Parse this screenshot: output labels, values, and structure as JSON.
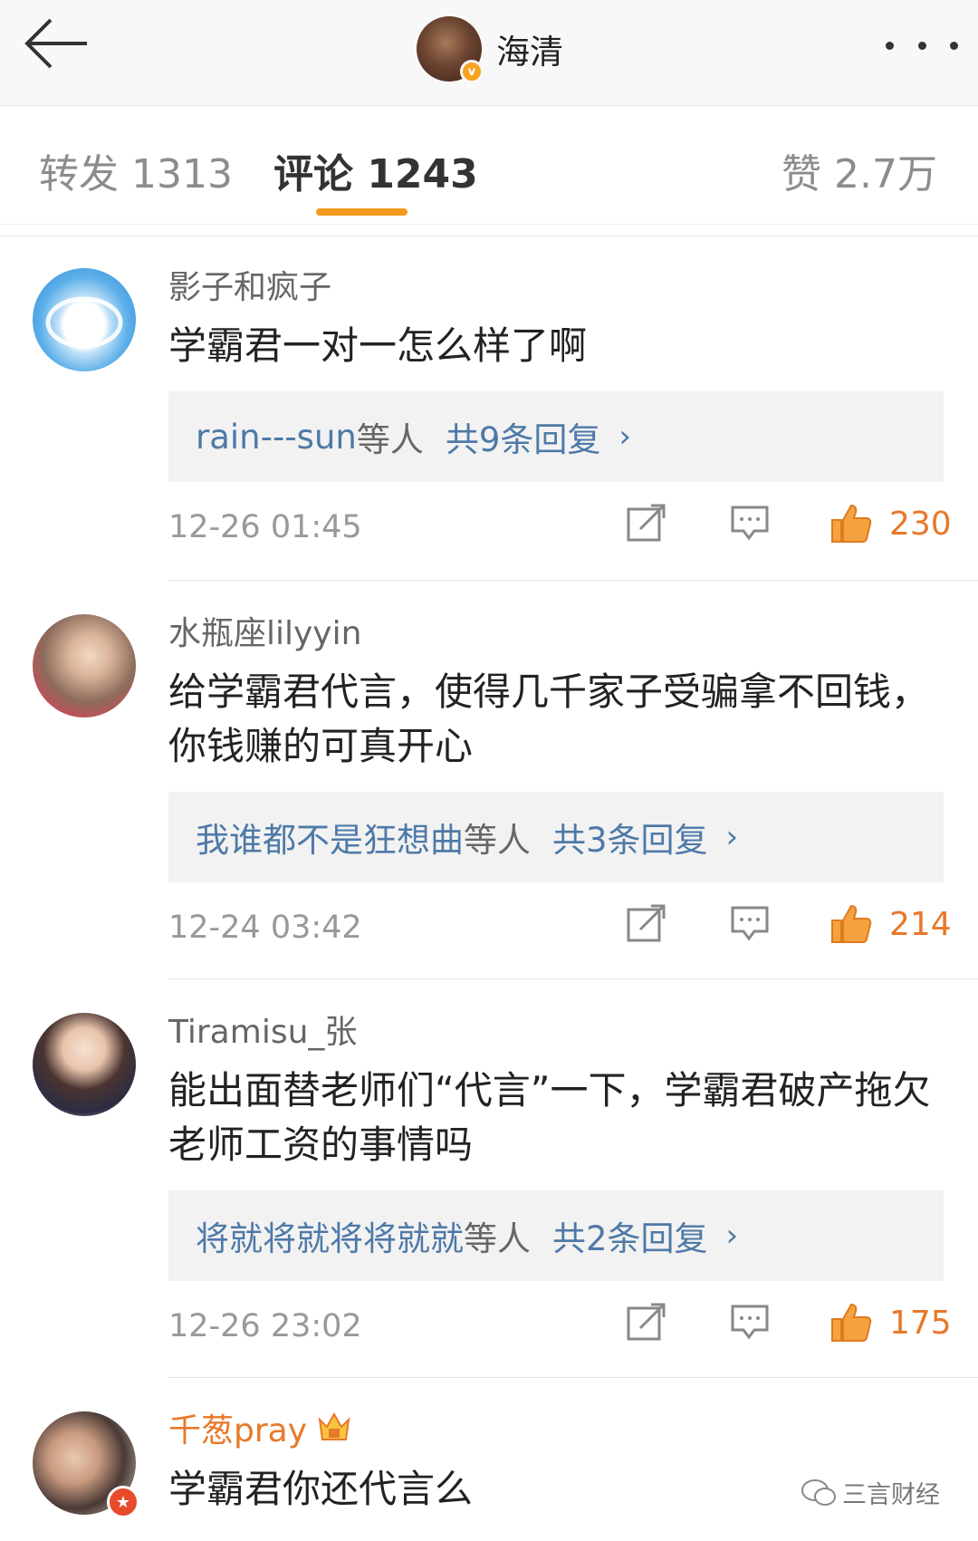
{
  "header": {
    "title": "海清",
    "back_icon": "back-arrow-icon",
    "more_icon": "more-dots-icon",
    "verified_badge": "v"
  },
  "tabs": {
    "repost": "转发 1313",
    "comments": "评论 1243",
    "likes": "赞 2.7万",
    "active": "comments",
    "accent_color": "#f39b1e"
  },
  "comments": [
    {
      "user": "影子和疯子",
      "text": "学霸君一对一怎么样了啊",
      "replies": {
        "users": "rain---sun",
        "suffix": "等人",
        "total": "共9条回复"
      },
      "time": "12-26 01:45",
      "likes": "230"
    },
    {
      "user": "水瓶座lilyyin",
      "text": "给学霸君代言，使得几千家子受骗拿不回钱，你钱赚的可真开心",
      "replies": {
        "users": "我谁都不是狂想曲",
        "suffix": "等人",
        "total": "共3条回复"
      },
      "time": "12-24 03:42",
      "likes": "214"
    },
    {
      "user": "Tiramisu_张",
      "text": "能出面替老师们“代言”一下，学霸君破产拖欠老师工资的事情吗",
      "replies": {
        "users": "将就将就将将就就",
        "suffix": "等人",
        "total": "共2条回复"
      },
      "time": "12-26 23:02",
      "likes": "175"
    },
    {
      "user": "千葱pray",
      "text": "学霸君你还代言么",
      "vip_color": "#e8782a"
    }
  ],
  "chevron": "›",
  "watermark": "三言财经"
}
